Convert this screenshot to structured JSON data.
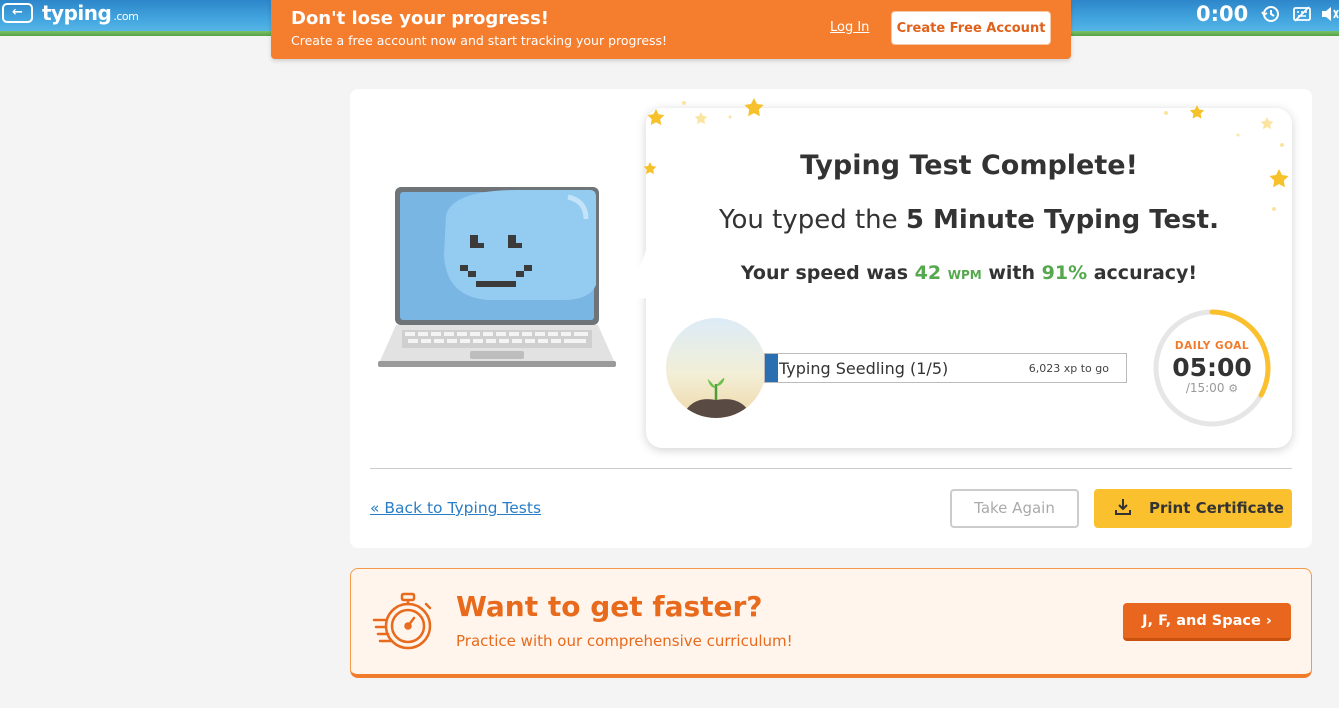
{
  "header": {
    "back_label": "←",
    "logo_main": "typing",
    "logo_suffix": ".com",
    "timer": "0:00",
    "icons": [
      "history-icon",
      "hide-keyboard-icon",
      "sound-icon"
    ]
  },
  "promo": {
    "title": "Don't lose your progress!",
    "subtitle": "Create a free account now and start tracking your progress!",
    "login_label": "Log In",
    "create_label": "Create Free Account"
  },
  "result": {
    "title": "Typing Test Complete!",
    "typed_prefix": "You typed the ",
    "test_name": "5 Minute Typing Test.",
    "speed_prefix": "Your speed was ",
    "wpm_value": "42",
    "wpm_unit": "WPM",
    "speed_mid": " with ",
    "accuracy": "91%",
    "speed_suffix": " accuracy!"
  },
  "level": {
    "label": "Typing Seedling (1/5)",
    "xp_to_go": "6,023 xp to go",
    "progress_fraction": 0.035
  },
  "daily_goal": {
    "label": "DAILY GOAL",
    "time": "05:00",
    "total": "/15:00",
    "progress_fraction": 0.33
  },
  "actions": {
    "back_link": "« Back to Typing Tests",
    "take_again": "Take Again",
    "print_certificate": "Print Certificate"
  },
  "faster": {
    "title": "Want to get faster?",
    "subtitle": "Practice with our comprehensive curriculum!",
    "button_label": "J, F, and Space ›"
  },
  "colors": {
    "orange": "#f47d2e",
    "green": "#55a84d",
    "yellow": "#fbc02d",
    "blue": "#2a6fb0"
  }
}
